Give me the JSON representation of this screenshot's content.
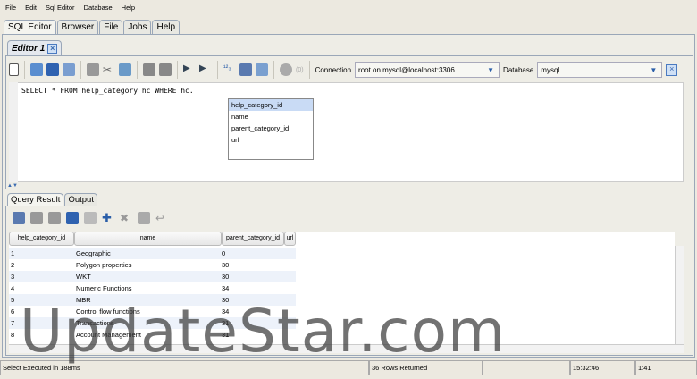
{
  "menu": [
    "File",
    "Edit",
    "Sql Editor",
    "Database",
    "Help"
  ],
  "main_tabs": [
    "SQL Editor",
    "Browser",
    "File",
    "Jobs",
    "Help"
  ],
  "editor_tab": "Editor 1",
  "toolbar": {
    "counter": "(0)",
    "connection_label": "Connection",
    "connection_value": "root on mysql@localhost:3306",
    "database_label": "Database",
    "database_value": "mysql"
  },
  "sql": "SELECT * FROM help_category hc WHERE hc.",
  "autocomplete": [
    "help_category_id",
    "name",
    "parent_category_id",
    "url"
  ],
  "result_tabs": [
    "Query Result",
    "Output"
  ],
  "table": {
    "columns": [
      "help_category_id",
      "name",
      "parent_category_id",
      "url"
    ],
    "rows": [
      [
        "1",
        "Geographic",
        "0",
        ""
      ],
      [
        "2",
        "Polygon properties",
        "30",
        ""
      ],
      [
        "3",
        "WKT",
        "30",
        ""
      ],
      [
        "4",
        "Numeric Functions",
        "34",
        ""
      ],
      [
        "5",
        "MBR",
        "30",
        ""
      ],
      [
        "6",
        "Control flow functions",
        "34",
        ""
      ],
      [
        "7",
        "Transactions",
        "31",
        ""
      ],
      [
        "8",
        "Account Management",
        "31",
        ""
      ]
    ]
  },
  "status": {
    "message": "Select Executed in 188ms",
    "rows": "36 Rows Returned",
    "extra": "",
    "time": "15:32:46",
    "position": "1:41"
  },
  "watermark": "UpdateStar.com"
}
